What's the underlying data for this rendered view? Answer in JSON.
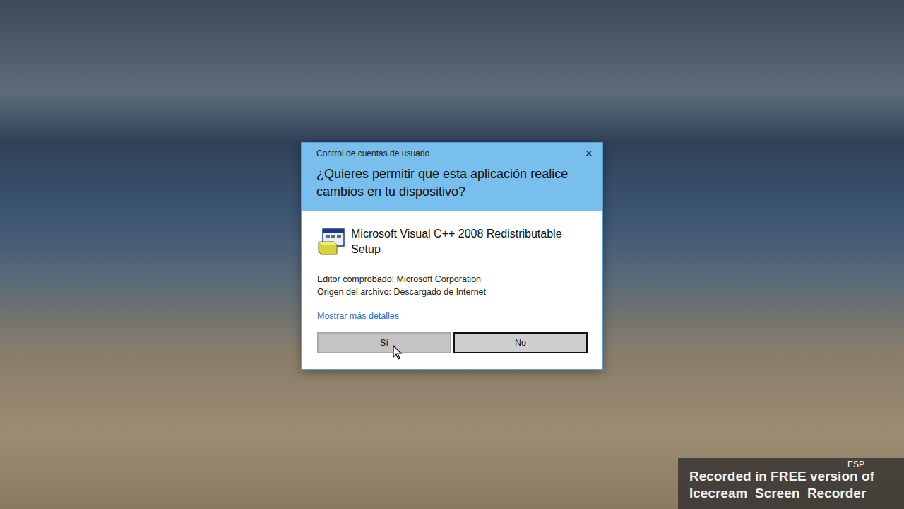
{
  "window": {
    "title": "Control de cuentas de usuario",
    "close": "×"
  },
  "question": "¿Quieres permitir que esta aplicación realice cambios en tu dispositivo?",
  "app": {
    "name": "Microsoft Visual C++ 2008 Redistributable Setup"
  },
  "details": [
    "Editor comprobado: Microsoft Corporation",
    "Origen del archivo: Descargado de Internet"
  ],
  "link": "Mostrar más detalles",
  "buttons": [
    {
      "label": "Sí",
      "focused": false,
      "hovered": true
    },
    {
      "label": "No",
      "focused": true,
      "hovered": false
    }
  ],
  "language": "ESP",
  "watermark": [
    "Recorded in FREE version of",
    "Icecream  Screen  Recorder"
  ]
}
